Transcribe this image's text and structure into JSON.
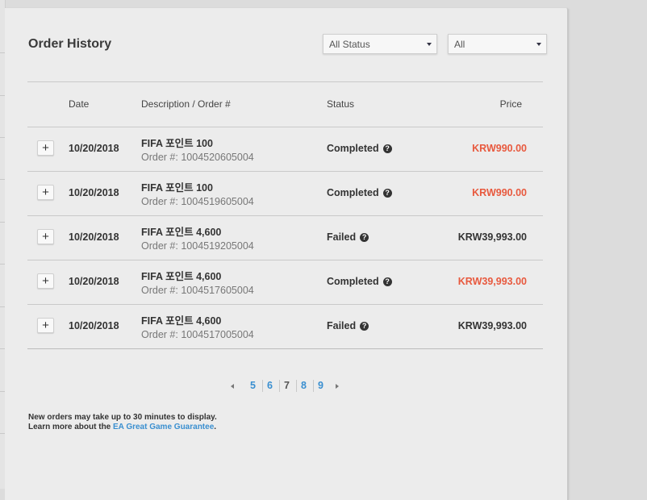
{
  "header": {
    "title": "Order History"
  },
  "filters": {
    "status_select": "All Status",
    "range_select": "All"
  },
  "table": {
    "columns": {
      "date": "Date",
      "description": "Description / Order #",
      "status": "Status",
      "price": "Price"
    },
    "order_label": "Order #:",
    "rows": [
      {
        "date": "10/20/2018",
        "description": "FIFA 포인트 100",
        "order_number": "1004520605004",
        "status": "Completed",
        "price": "KRW990.00",
        "price_color": "#e8593e"
      },
      {
        "date": "10/20/2018",
        "description": "FIFA 포인트 100",
        "order_number": "1004519605004",
        "status": "Completed",
        "price": "KRW990.00",
        "price_color": "#e8593e"
      },
      {
        "date": "10/20/2018",
        "description": "FIFA 포인트 4,600",
        "order_number": "1004519205004",
        "status": "Failed",
        "price": "KRW39,993.00",
        "price_color": "#333333"
      },
      {
        "date": "10/20/2018",
        "description": "FIFA 포인트 4,600",
        "order_number": "1004517605004",
        "status": "Completed",
        "price": "KRW39,993.00",
        "price_color": "#e8593e"
      },
      {
        "date": "10/20/2018",
        "description": "FIFA 포인트 4,600",
        "order_number": "1004517005004",
        "status": "Failed",
        "price": "KRW39,993.00",
        "price_color": "#333333"
      }
    ]
  },
  "pagination": {
    "pages": [
      "5",
      "6",
      "7",
      "8",
      "9"
    ],
    "current": "7"
  },
  "footer": {
    "line1": "New orders may take up to 30 minutes to display.",
    "line2_prefix": "Learn more about the ",
    "link_text": "EA Great Game Guarantee",
    "line2_suffix": "."
  },
  "colors": {
    "accent_link": "#3a8fd0",
    "price_red": "#e8593e"
  }
}
